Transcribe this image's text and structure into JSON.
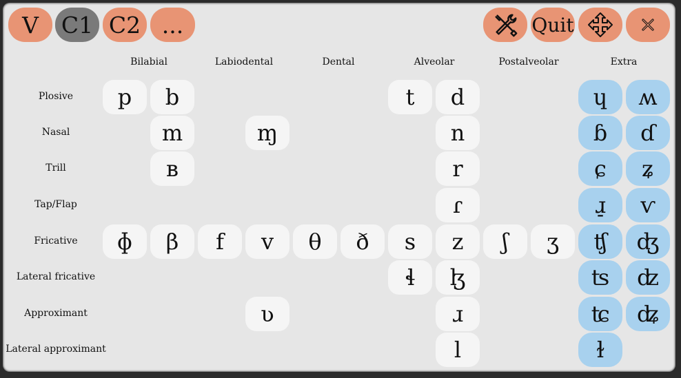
{
  "toolbar": {
    "v_label": "V",
    "c1_label": "C1",
    "c2_label": "C2",
    "more_label": "...",
    "quit_label": "Quit",
    "settings_icon": "wrench-screwdriver-icon",
    "move_icon": "move-arrows-icon",
    "close_icon": "close-icon",
    "colors": {
      "button": "#e89474",
      "active": "#7a7a7a",
      "extra": "#a8d1ee"
    }
  },
  "columns": [
    "Bilabial",
    "Labiodental",
    "Dental",
    "Alveolar",
    "Postalveolar",
    "Extra"
  ],
  "rows": [
    {
      "label": "Plosive",
      "cells": [
        "p",
        "b",
        "",
        "",
        "",
        "",
        "t",
        "d",
        "",
        ""
      ],
      "extra": [
        "ɥ",
        "ʍ"
      ]
    },
    {
      "label": "Nasal",
      "cells": [
        "",
        "m",
        "",
        "ɱ",
        "",
        "",
        "",
        "n",
        "",
        ""
      ],
      "extra": [
        "ɓ",
        "ɗ"
      ]
    },
    {
      "label": "Trill",
      "cells": [
        "",
        "ʙ",
        "",
        "",
        "",
        "",
        "",
        "r",
        "",
        ""
      ],
      "extra": [
        "ɕ",
        "ʑ"
      ]
    },
    {
      "label": "Tap/Flap",
      "cells": [
        "",
        "",
        "",
        "",
        "",
        "",
        "",
        "ɾ",
        "",
        ""
      ],
      "extra": [
        "ɹ̠",
        "ⱱ"
      ]
    },
    {
      "label": "Fricative",
      "cells": [
        "ɸ",
        "β",
        "f",
        "v",
        "θ",
        "ð",
        "s",
        "z",
        "ʃ",
        "ʒ"
      ],
      "extra": [
        "ʧ",
        "ʤ"
      ]
    },
    {
      "label": "Lateral fricative",
      "cells": [
        "",
        "",
        "",
        "",
        "",
        "",
        "ɬ",
        "ɮ",
        "",
        ""
      ],
      "extra": [
        "ʦ",
        "ʣ"
      ]
    },
    {
      "label": "Approximant",
      "cells": [
        "",
        "",
        "",
        "ʋ",
        "",
        "",
        "",
        "ɹ",
        "",
        ""
      ],
      "extra": [
        "ʨ",
        "ʥ"
      ]
    },
    {
      "label": "Lateral approximant",
      "cells": [
        "",
        "",
        "",
        "",
        "",
        "",
        "",
        "l",
        "",
        ""
      ],
      "extra": [
        "ɫ",
        ""
      ]
    }
  ]
}
